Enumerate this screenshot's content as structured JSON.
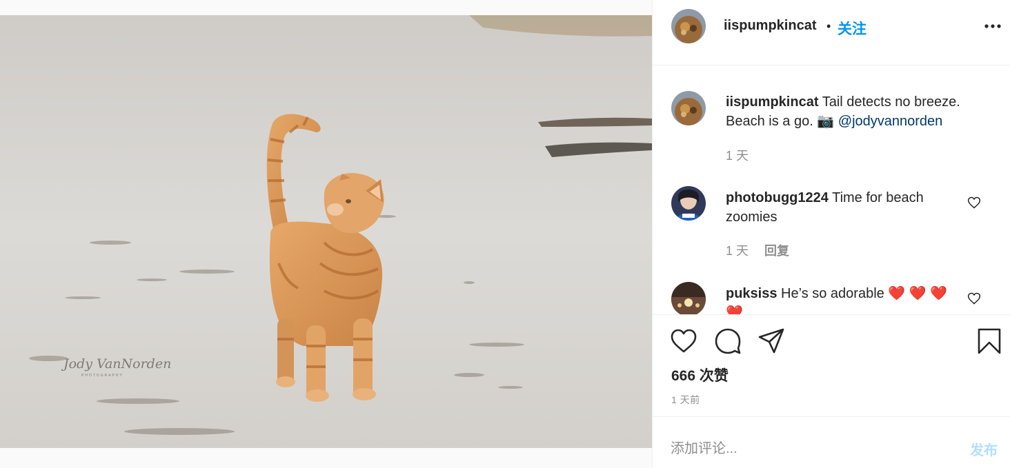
{
  "post": {
    "image_alt": "Orange tabby cat standing on a sandy beach with its tail up",
    "watermark": "Jody VanNorden",
    "watermark_sub": "PHOTOGRAPHY"
  },
  "header": {
    "username": "iispumpkincat",
    "separator": "•",
    "follow_label": "关注",
    "more_icon": "more-horizontal-icon"
  },
  "caption": {
    "username": "iispumpkincat",
    "text": "Tail detects no breeze. Beach is a go.",
    "emoji": "📷",
    "mention": "@jodyvannorden",
    "time": "1 天"
  },
  "comments": [
    {
      "username": "photobugg1224",
      "text": "Time for beach zoomies",
      "time": "1 天",
      "reply_label": "回复"
    },
    {
      "username": "puksiss",
      "text": "He’s so adorable ❤️ ❤️ ❤️ ❤️"
    }
  ],
  "actions": {
    "like_icon": "heart-icon",
    "comment_icon": "comment-icon",
    "share_icon": "share-icon",
    "save_icon": "bookmark-icon"
  },
  "likes": "666 次赞",
  "posted_time": "1 天前",
  "comment_box": {
    "placeholder": "添加评论...",
    "post_label": "发布"
  },
  "colors": {
    "accent": "#0095f6",
    "post_disabled": "#b2dffc",
    "text": "#262626",
    "muted": "#8e8e8e"
  }
}
